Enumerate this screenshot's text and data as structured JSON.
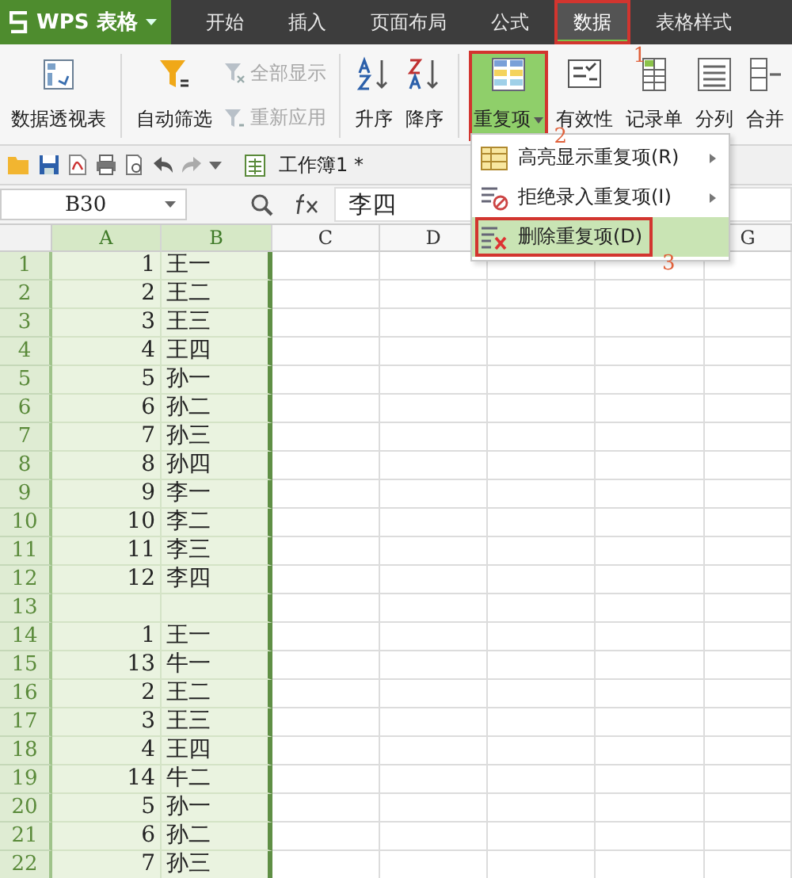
{
  "app": {
    "name": "WPS 表格"
  },
  "tabs": [
    {
      "label": "开始",
      "selected": false
    },
    {
      "label": "插入",
      "selected": false
    },
    {
      "label": "页面布局",
      "selected": false
    },
    {
      "label": "公式",
      "selected": false
    },
    {
      "label": "数据",
      "selected": true,
      "annotated": true,
      "marker": "1"
    },
    {
      "label": "表格样式",
      "selected": false
    }
  ],
  "ribbon": [
    {
      "kind": "big",
      "label": "数据透视表"
    },
    {
      "kind": "big",
      "label": "自动筛选"
    },
    {
      "kind": "stack",
      "items": [
        {
          "label": "全部显示",
          "disabled": true
        },
        {
          "label": "重新应用",
          "disabled": true
        }
      ]
    },
    {
      "kind": "big",
      "label": "升序"
    },
    {
      "kind": "big",
      "label": "降序"
    },
    {
      "kind": "big",
      "label": "重复项",
      "expanded": true,
      "annotated": true,
      "marker": "2"
    },
    {
      "kind": "big",
      "label": "有效性"
    },
    {
      "kind": "big",
      "label": "记录单"
    },
    {
      "kind": "big",
      "label": "分列"
    },
    {
      "kind": "big",
      "label": "合并"
    }
  ],
  "quick_access": {
    "document": "工作簿1 *"
  },
  "formula_bar": {
    "name_box": "B30",
    "formula": "李四"
  },
  "menu": [
    {
      "label": "高亮显示重复项(R)",
      "submenu": true,
      "selected": false,
      "annotated": false
    },
    {
      "label": "拒绝录入重复项(I)",
      "submenu": true,
      "selected": false,
      "annotated": false
    },
    {
      "label": "删除重复项(D)",
      "submenu": false,
      "selected": true,
      "annotated": true,
      "marker": "3"
    }
  ],
  "columns": [
    {
      "label": "A",
      "selected": true
    },
    {
      "label": "B",
      "selected": true
    },
    {
      "label": "C",
      "selected": false
    },
    {
      "label": "D",
      "selected": false
    },
    {
      "label": "G",
      "selected": false
    }
  ],
  "rows": [
    {
      "n": "1",
      "a": "1",
      "b": "王一"
    },
    {
      "n": "2",
      "a": "2",
      "b": "王二"
    },
    {
      "n": "3",
      "a": "3",
      "b": "王三"
    },
    {
      "n": "4",
      "a": "4",
      "b": "王四"
    },
    {
      "n": "5",
      "a": "5",
      "b": "孙一"
    },
    {
      "n": "6",
      "a": "6",
      "b": "孙二"
    },
    {
      "n": "7",
      "a": "7",
      "b": "孙三"
    },
    {
      "n": "8",
      "a": "8",
      "b": "孙四"
    },
    {
      "n": "9",
      "a": "9",
      "b": "李一"
    },
    {
      "n": "10",
      "a": "10",
      "b": "李二"
    },
    {
      "n": "11",
      "a": "11",
      "b": "李三"
    },
    {
      "n": "12",
      "a": "12",
      "b": "李四"
    },
    {
      "n": "13"
    },
    {
      "n": "14",
      "a": "1",
      "b": "王一"
    },
    {
      "n": "15",
      "a": "13",
      "b": "牛一"
    },
    {
      "n": "16",
      "a": "2",
      "b": "王二"
    },
    {
      "n": "17",
      "a": "3",
      "b": "王三"
    },
    {
      "n": "18",
      "a": "4",
      "b": "王四"
    },
    {
      "n": "19",
      "a": "14",
      "b": "牛二"
    },
    {
      "n": "20",
      "a": "5",
      "b": "孙一"
    },
    {
      "n": "21",
      "a": "6",
      "b": "孙二"
    },
    {
      "n": "22",
      "a": "7",
      "b": "孙三"
    }
  ]
}
